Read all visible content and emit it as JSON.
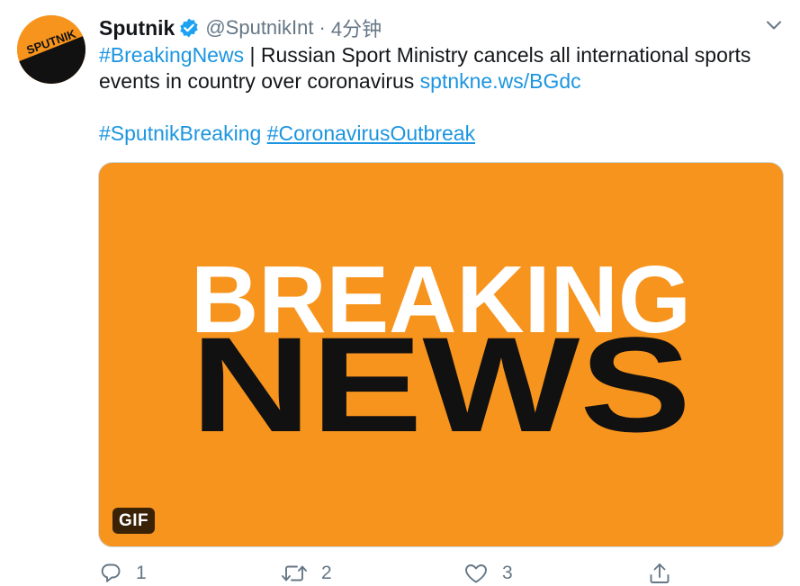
{
  "account": {
    "name": "Sputnik",
    "handle": "@SputnikInt",
    "separator": "·",
    "time": "4分钟",
    "avatar_text": "SPUTNIK",
    "brand_color": "#f7941d"
  },
  "tweet": {
    "hashtag1": "#BreakingNews",
    "body": " | Russian Sport Ministry cancels all international sports events in country over coronavirus ",
    "link": "sptnkne.ws/BGdc",
    "hashtag2": "#SputnikBreaking",
    "hashtag3": "#CoronavirusOutbreak"
  },
  "media": {
    "line1": "BREAKING",
    "line2": "NEWS",
    "badge": "GIF",
    "background": "#f7941d"
  },
  "actions": {
    "reply": {
      "icon": "reply-icon",
      "count": "1"
    },
    "retweet": {
      "icon": "retweet-icon",
      "count": "2"
    },
    "like": {
      "icon": "heart-icon",
      "count": "3"
    },
    "share": {
      "icon": "share-icon"
    }
  },
  "colors": {
    "link": "#1b95e0",
    "verified": "#1da1f2",
    "muted": "#657786"
  }
}
